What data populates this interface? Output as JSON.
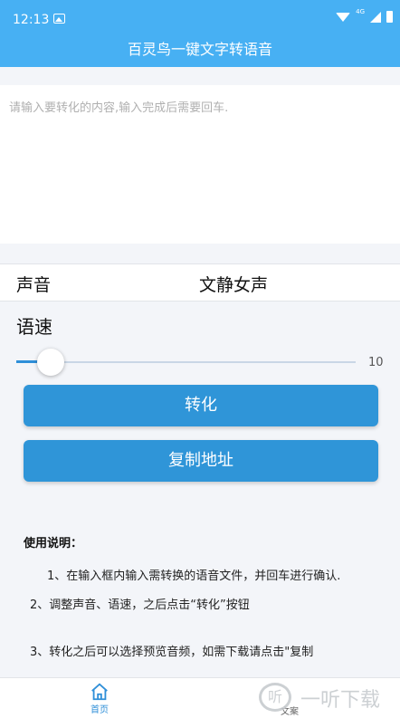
{
  "status_bar": {
    "time": "12:13",
    "network": "4G"
  },
  "app_bar": {
    "title": "百灵鸟一键文字转语音"
  },
  "input": {
    "placeholder": "请输入要转化的内容,输入完成后需要回车.",
    "value": ""
  },
  "voice": {
    "label": "声音",
    "value": "文静女声"
  },
  "speed": {
    "label": "语速",
    "value": "10",
    "level": 0.1
  },
  "buttons": {
    "convert": "转化",
    "copy": "复制地址"
  },
  "instructions": {
    "heading": "使用说明：",
    "items": [
      "1、在输入框内输入需转换的语音文件，并回车进行确认.",
      "2、调整声音、语速，之后点击“转化”按钮",
      "3、转化之后可以选择预览音频，如需下载请点击\"复制"
    ]
  },
  "tabs": {
    "home": "首页",
    "docs": "文案"
  },
  "watermark": {
    "text": "一听下载"
  },
  "colors": {
    "primary": "#47b0f3",
    "button": "#2f95d8",
    "background": "#f3f5f9"
  }
}
